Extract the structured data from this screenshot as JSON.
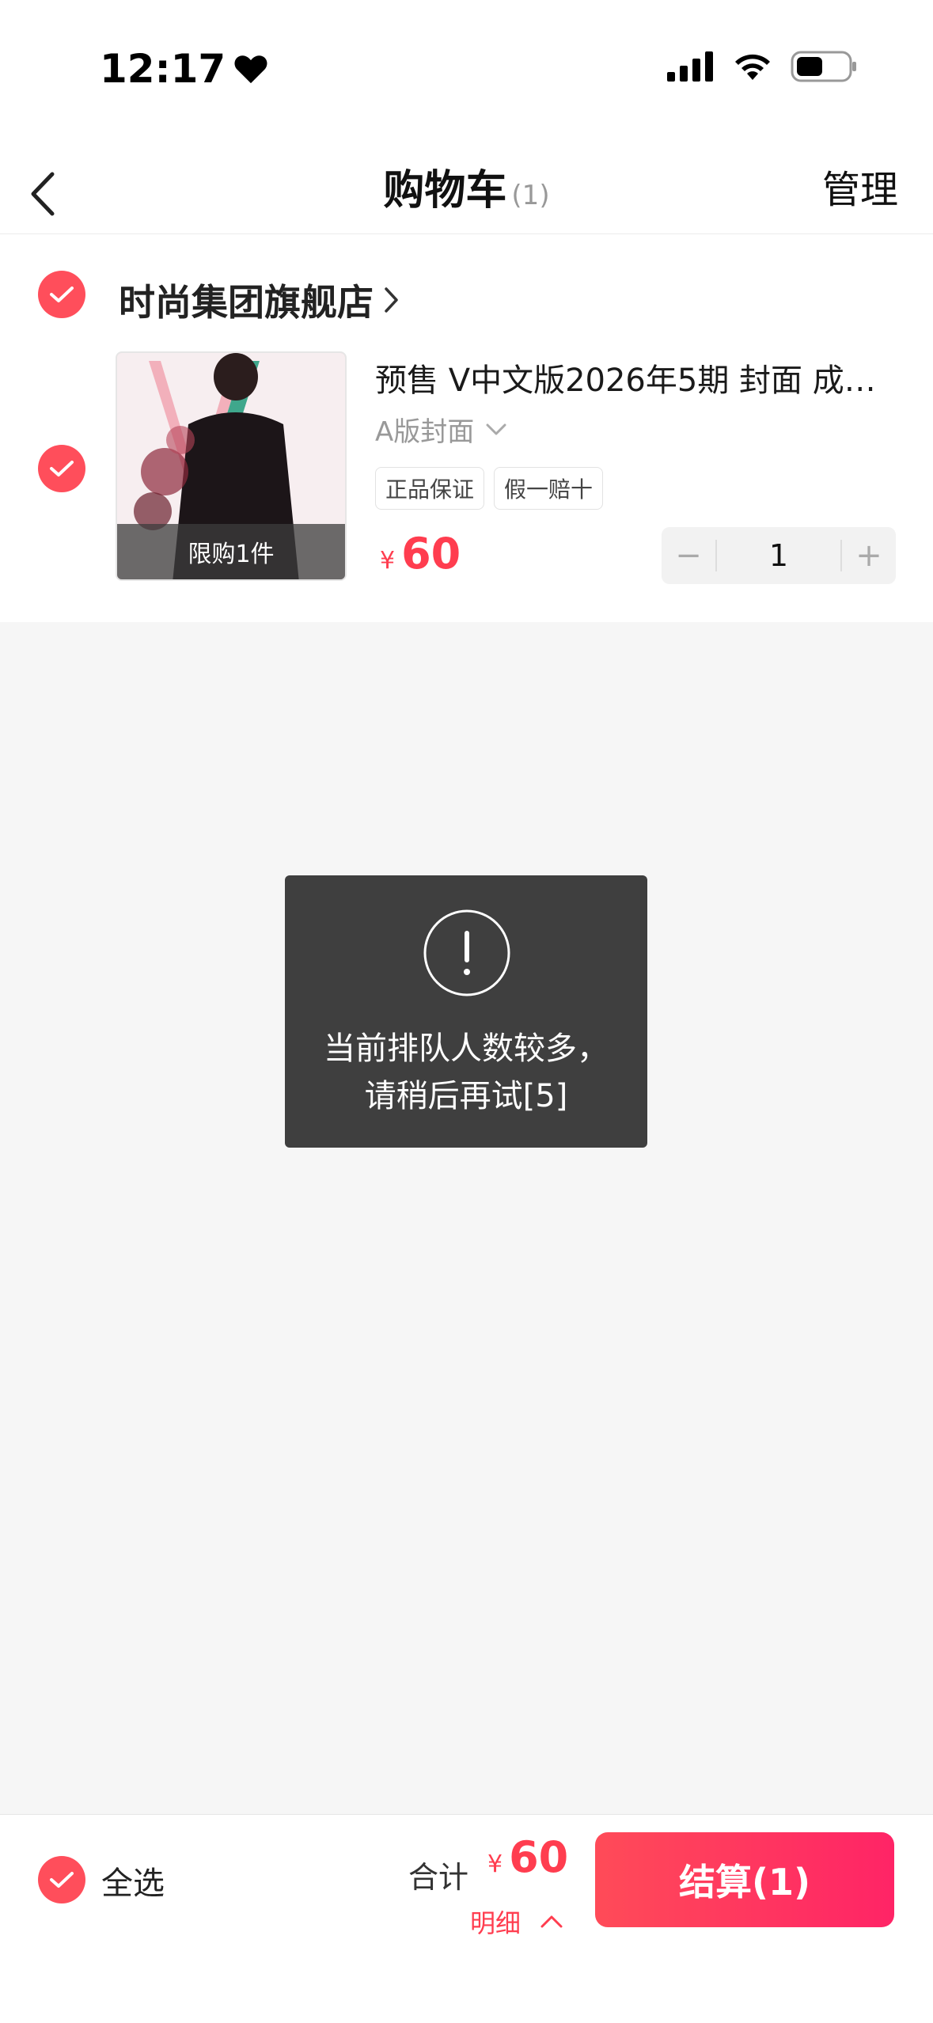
{
  "status_bar": {
    "time": "12:17"
  },
  "nav": {
    "title": "购物车",
    "count": "(1)",
    "manage": "管理"
  },
  "shop": {
    "name": "时尚集团旗舰店",
    "item": {
      "title": "预售 V中文版2026年5期 封面 成…",
      "variant": "A版封面",
      "limit_label": "限购1件",
      "tags": [
        "正品保证",
        "假一赔十"
      ],
      "price_symbol": "¥",
      "price": "60",
      "quantity": "1",
      "minus": "−",
      "plus": "+"
    }
  },
  "toast": {
    "line1": "当前排队人数较多，",
    "line2": "请稍后再试[5]"
  },
  "footer": {
    "select_all": "全选",
    "total_label": "合计",
    "total_symbol": "¥",
    "total_value": "60",
    "detail": "明细",
    "checkout": "结算(1)"
  },
  "colors": {
    "accent": "#ff4e5b",
    "price": "#ff3d4f",
    "toast_bg": "#3f3f3f"
  },
  "icons": [
    "heart-icon",
    "signal-icon",
    "wifi-icon",
    "battery-icon",
    "back-icon",
    "check-icon",
    "chevron-right-icon",
    "chevron-down-icon",
    "exclamation-icon",
    "chevron-up-icon"
  ]
}
